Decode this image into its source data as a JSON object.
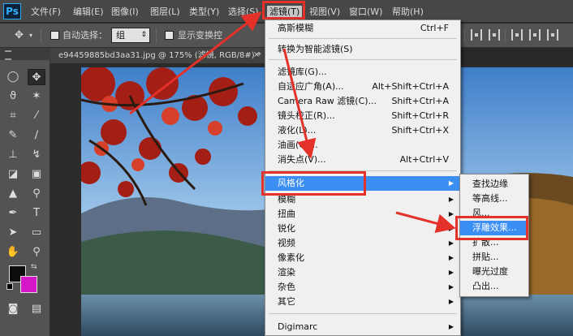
{
  "app": {
    "logo": "Ps"
  },
  "menubar": {
    "items": [
      "文件(F)",
      "编辑(E)",
      "图像(I)",
      "图层(L)",
      "类型(Y)",
      "选择(S)",
      "滤镜(T)",
      "视图(V)",
      "窗口(W)",
      "帮助(H)"
    ]
  },
  "options_bar": {
    "auto_select_label": "自动选择：",
    "auto_select_value": "组",
    "show_transform_label": "显示变换控"
  },
  "document": {
    "tab_title": "e94459885bd3aa31.jpg @ 175% (滤镜, RGB/8#) *",
    "close": "×"
  },
  "filter_menu": {
    "items": [
      {
        "label": "高斯模糊",
        "shortcut": "Ctrl+F"
      },
      {
        "label": "转换为智能滤镜(S)",
        "shortcut": ""
      },
      {
        "label": "滤镜库(G)...",
        "shortcut": ""
      },
      {
        "label": "自适应广角(A)...",
        "shortcut": "Alt+Shift+Ctrl+A"
      },
      {
        "label": "Camera Raw 滤镜(C)...",
        "shortcut": "Shift+Ctrl+A"
      },
      {
        "label": "镜头校正(R)...",
        "shortcut": "Shift+Ctrl+R"
      },
      {
        "label": "液化(L)...",
        "shortcut": "Shift+Ctrl+X"
      },
      {
        "label": "油画(O)...",
        "shortcut": ""
      },
      {
        "label": "消失点(V)...",
        "shortcut": "Alt+Ctrl+V"
      },
      {
        "label": "风格化",
        "shortcut": ""
      },
      {
        "label": "模糊",
        "shortcut": ""
      },
      {
        "label": "扭曲",
        "shortcut": ""
      },
      {
        "label": "锐化",
        "shortcut": ""
      },
      {
        "label": "视频",
        "shortcut": ""
      },
      {
        "label": "像素化",
        "shortcut": ""
      },
      {
        "label": "渲染",
        "shortcut": ""
      },
      {
        "label": "杂色",
        "shortcut": ""
      },
      {
        "label": "其它",
        "shortcut": ""
      },
      {
        "label": "Digimarc",
        "shortcut": ""
      }
    ],
    "submenu_arrow": "▶"
  },
  "stylize_submenu": {
    "items": [
      "查找边缘",
      "等高线...",
      "风...",
      "浮雕效果...",
      "扩散...",
      "拼贴...",
      "曝光过度",
      "凸出..."
    ]
  },
  "colors": {
    "highlight": "#3b8ff3",
    "annotation_red": "#e4322b",
    "foreground": "#0d0d0d",
    "background": "#d617c8"
  }
}
